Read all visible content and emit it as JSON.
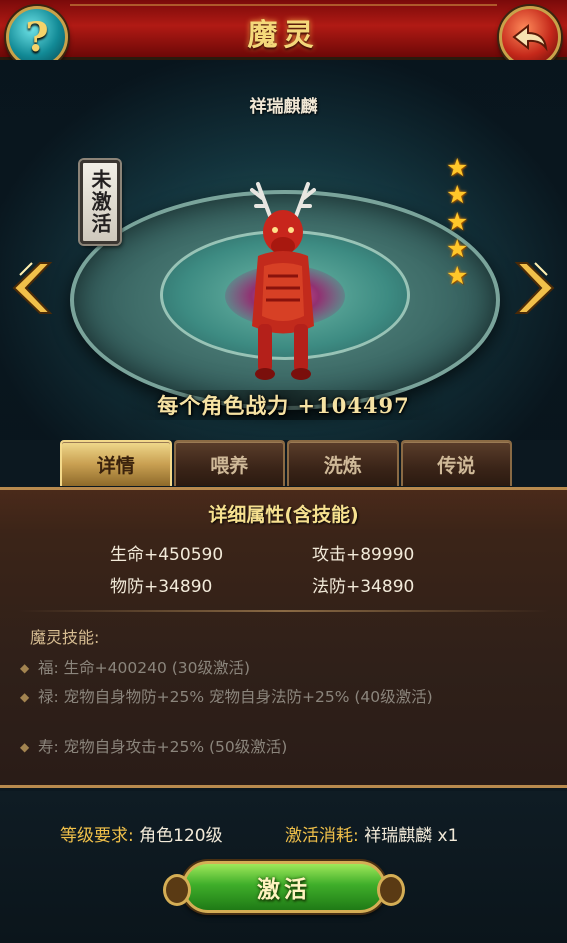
{
  "header": {
    "title": "魔灵",
    "help_icon_glyph": "?",
    "help_label": "帮助",
    "back_icon_glyph": "↶",
    "back_label": "返回"
  },
  "pet": {
    "name": "祥瑞麒麟",
    "status": "未激活",
    "stars": 5,
    "power_text": "每个角色战力 +104497"
  },
  "tabs": [
    {
      "label": "详情",
      "active": true
    },
    {
      "label": "喂养",
      "active": false
    },
    {
      "label": "洗炼",
      "active": false
    },
    {
      "label": "传说",
      "active": false
    }
  ],
  "details": {
    "title": "详细属性(含技能)",
    "attributes": [
      {
        "text": "生命+450590"
      },
      {
        "text": "攻击+89990"
      },
      {
        "text": "物防+34890"
      },
      {
        "text": "法防+34890"
      }
    ],
    "skills_heading": "魔灵技能:",
    "skills": [
      {
        "text": "福: 生命+400240 (30级激活)"
      },
      {
        "text": "禄: 宠物自身物防+25% 宠物自身法防+25% (40级激活)"
      },
      {
        "text": "寿: 宠物自身攻击+25% (50级激活)"
      }
    ]
  },
  "footer": {
    "level_req_label": "等级要求:",
    "level_req_value": "角色120级",
    "cost_label": "激活消耗:",
    "cost_value": "祥瑞麒麟  x1",
    "activate_label": "激活"
  },
  "colors": {
    "header_red": "#b01a14",
    "gold": "#f0c04a",
    "activate_green": "#3fae2a",
    "star": "#ffc72a"
  }
}
